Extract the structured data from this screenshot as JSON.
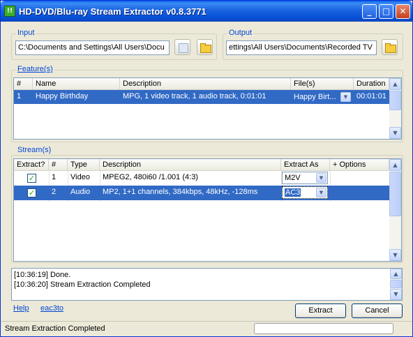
{
  "window": {
    "title": "HD-DVD/Blu-ray Stream Extractor v0.8.3771",
    "icon_text": "!!"
  },
  "input": {
    "label": "Input",
    "value": "C:\\Documents and Settings\\All Users\\Docu"
  },
  "output": {
    "label": "Output",
    "value": "ettings\\All Users\\Documents\\Recorded TV"
  },
  "features": {
    "label": "Feature(s)",
    "columns": [
      "#",
      "Name",
      "Description",
      "File(s)",
      "Duration"
    ],
    "rows": [
      {
        "num": "1",
        "name": "Happy Birthday",
        "description": "MPG, 1 video track, 1 audio track, 0:01:01",
        "file": "Happy Birt...",
        "duration": "00:01:01",
        "selected": true
      }
    ]
  },
  "streams": {
    "label": "Stream(s)",
    "columns": [
      "Extract?",
      "#",
      "Type",
      "Description",
      "Extract As",
      "+ Options"
    ],
    "rows": [
      {
        "extract": true,
        "num": "1",
        "type": "Video",
        "description": "MPEG2, 480i60 /1.001 (4:3)",
        "extract_as": "M2V",
        "selected": false
      },
      {
        "extract": true,
        "num": "2",
        "type": "Audio",
        "description": "MP2, 1+1 channels, 384kbps, 48kHz, -128ms",
        "extract_as": "AC3",
        "selected": true
      }
    ]
  },
  "log": {
    "lines": [
      "[10:36:19] Done.",
      "[10:36:20] Stream Extraction Completed"
    ]
  },
  "links": {
    "help": "Help",
    "eac3to": "eac3to"
  },
  "buttons": {
    "extract": "Extract",
    "cancel": "Cancel"
  },
  "status": {
    "text": "Stream Extraction Completed",
    "progress": 0
  },
  "colors": {
    "selection": "#316ac5",
    "titlebar": "#0550d6",
    "link": "#0046d5"
  }
}
